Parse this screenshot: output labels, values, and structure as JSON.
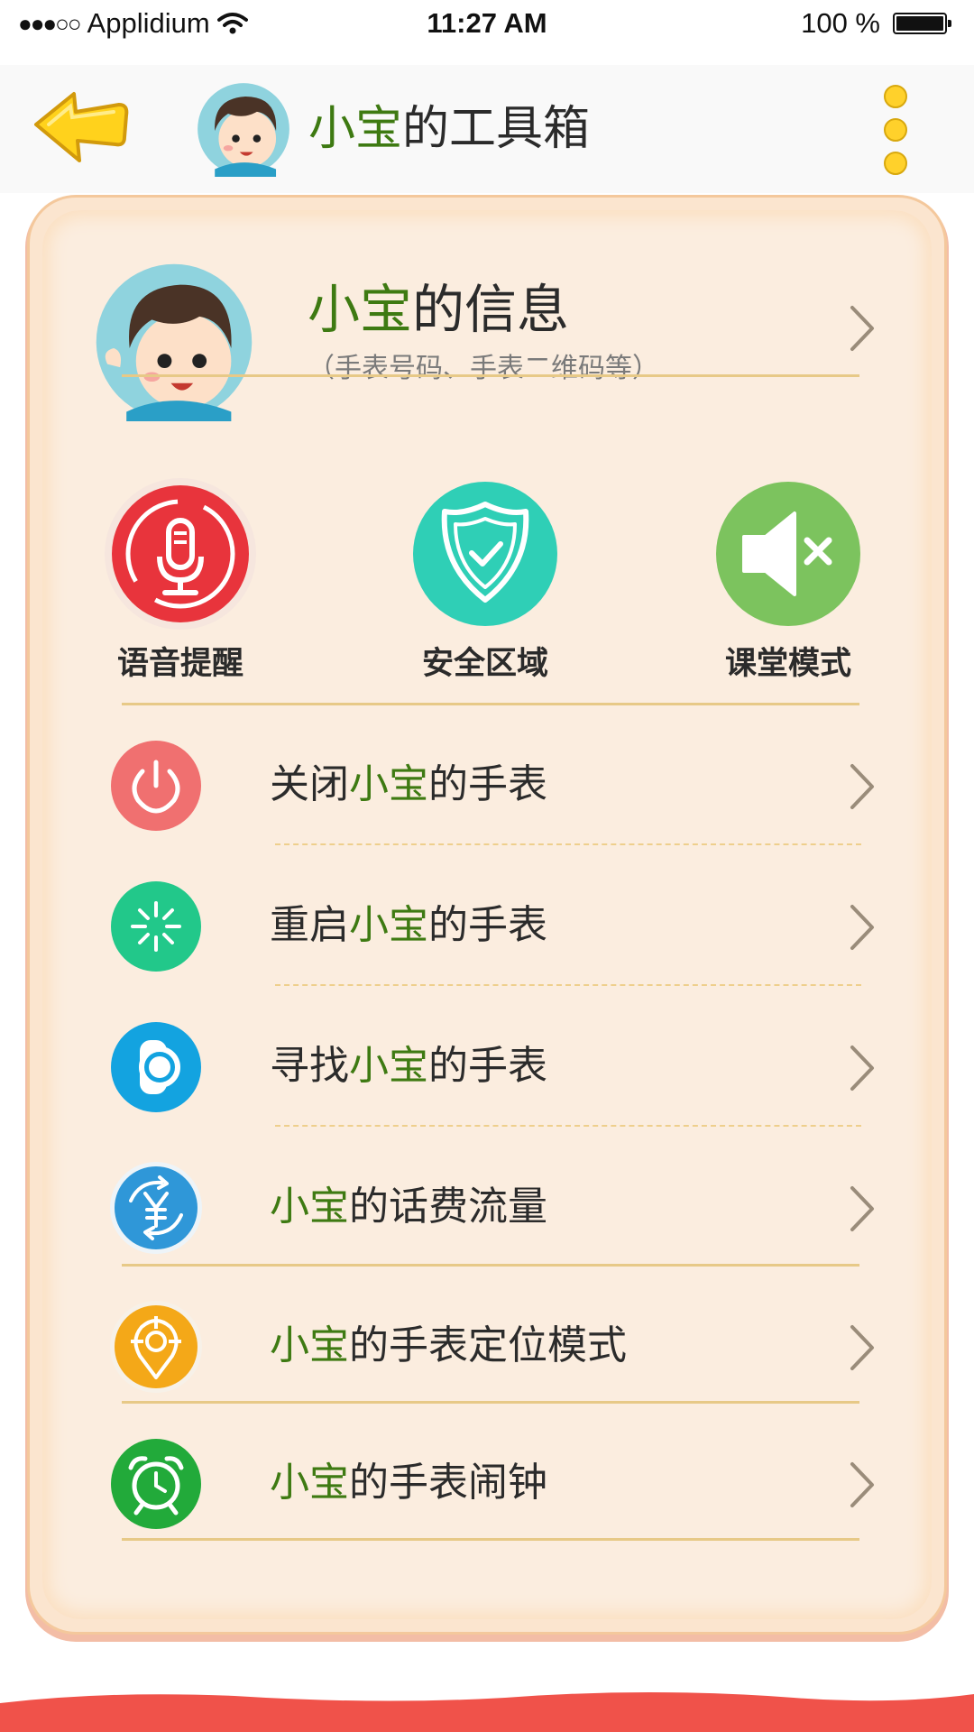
{
  "status_bar": {
    "signal_dots": "●●●○○",
    "carrier": "Applidium",
    "time": "11:27 AM",
    "battery_percent": "100 %"
  },
  "nav": {
    "title_highlight": "小宝",
    "title_rest": "的工具箱",
    "back_icon": "back-arrow-icon",
    "more_icon": "more-vertical-icon"
  },
  "profile": {
    "title_highlight": "小宝",
    "title_rest": "的信息",
    "subtitle": "（手表号码、手表二维码等）"
  },
  "quick_actions": [
    {
      "label": "语音提醒",
      "icon": "microphone-icon",
      "color": "#e8343c"
    },
    {
      "label": "安全区域",
      "icon": "shield-check-icon",
      "color": "#2fcfb6"
    },
    {
      "label": "课堂模式",
      "icon": "speaker-mute-icon",
      "color": "#7cc35e"
    }
  ],
  "rows": [
    {
      "pre": "关闭",
      "highlight": "小宝",
      "post": "的手表",
      "icon": "power-icon",
      "color": "#f07070"
    },
    {
      "pre": "重启",
      "highlight": "小宝",
      "post": "的手表",
      "icon": "restart-spinner-icon",
      "color": "#22c88a"
    },
    {
      "pre": "寻找",
      "highlight": "小宝",
      "post": "的手表",
      "icon": "watch-search-icon",
      "color": "#13a3e0"
    },
    {
      "pre": "",
      "highlight": "小宝",
      "post": "的话费流量",
      "icon": "yuan-refresh-icon",
      "color": "#2f97d8"
    },
    {
      "pre": "",
      "highlight": "小宝",
      "post": "的手表定位模式",
      "icon": "location-target-icon",
      "color": "#f4a818"
    },
    {
      "pre": "",
      "highlight": "小宝",
      "post": "的手表闹钟",
      "icon": "alarm-clock-icon",
      "color": "#22aa3a"
    }
  ],
  "colors": {
    "highlight_text": "#3e7a12",
    "card_bg": "#fbeddf",
    "divider": "#e7c987",
    "wave": "#f0524a"
  }
}
